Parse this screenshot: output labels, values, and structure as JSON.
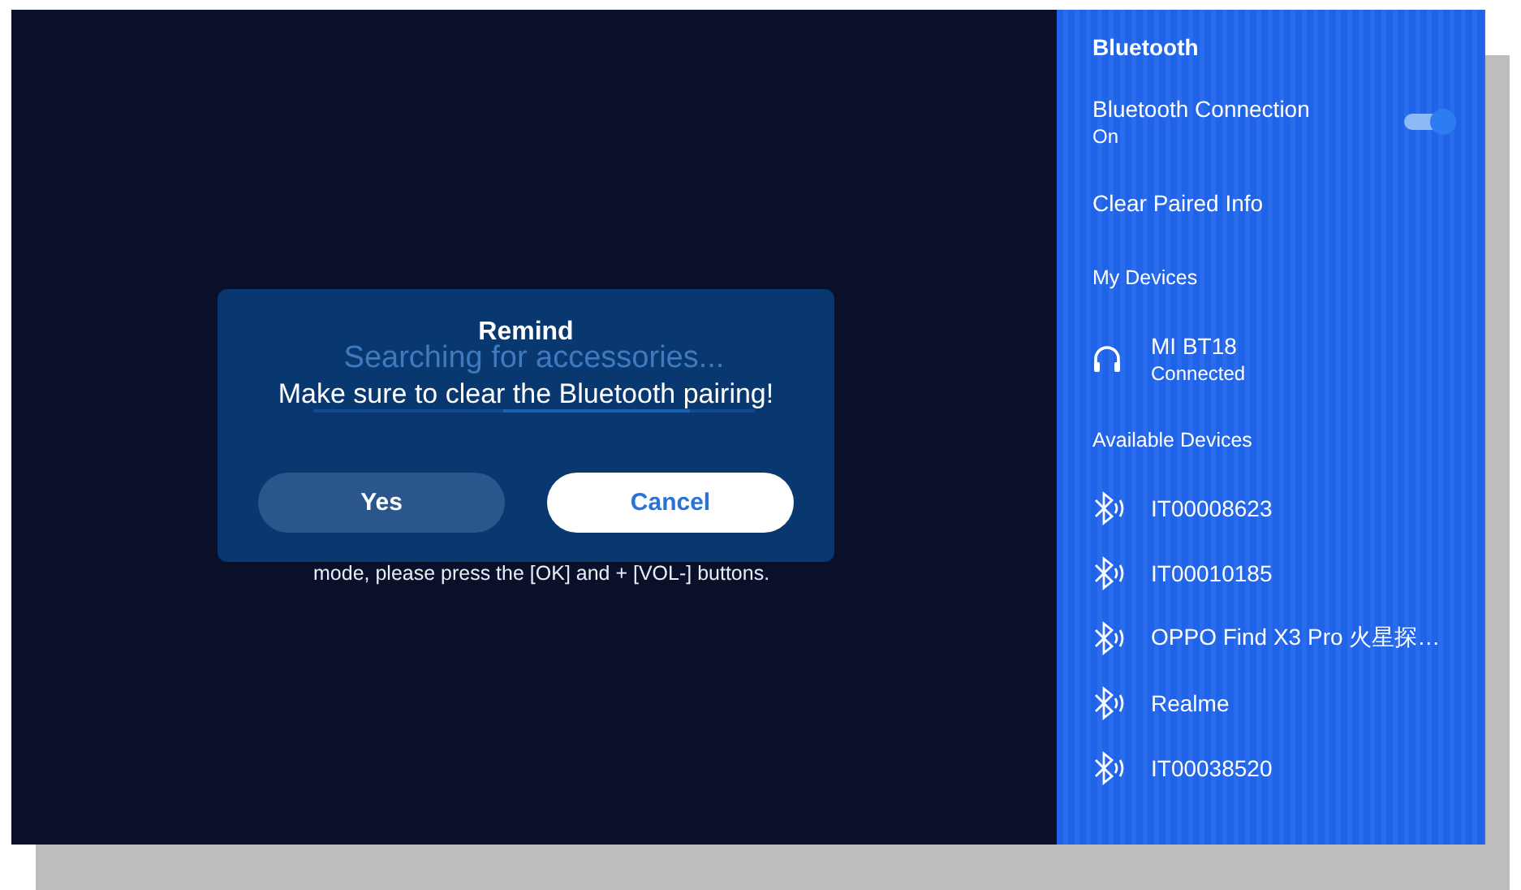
{
  "scan": {
    "title": "Searching for accessories...",
    "hints": [
      "mode, please press the [OK] and + [VOL-] buttons."
    ]
  },
  "dialog": {
    "title": "Remind",
    "message": "Make sure to clear the Bluetooth pairing!",
    "buttons": [
      {
        "label": "Yes",
        "selected": false
      },
      {
        "label": "Cancel",
        "selected": true
      }
    ]
  },
  "panel": {
    "title": "Bluetooth",
    "items": [
      {
        "kind": "toggle",
        "label": "Bluetooth Connection",
        "value": "On",
        "on": true
      },
      {
        "kind": "action",
        "label": "Clear Paired Info"
      },
      {
        "kind": "header",
        "label": "My Devices"
      },
      {
        "kind": "paired",
        "name": "MI BT18",
        "status": "Connected"
      },
      {
        "kind": "header",
        "label": "Available Devices"
      },
      {
        "kind": "available",
        "name": "IT00008623"
      },
      {
        "kind": "available",
        "name": "IT00010185"
      },
      {
        "kind": "available",
        "name": "OPPO Find X3 Pro 火星探…"
      },
      {
        "kind": "available",
        "name": "Realme"
      },
      {
        "kind": "available",
        "name": "IT00038520"
      }
    ]
  }
}
